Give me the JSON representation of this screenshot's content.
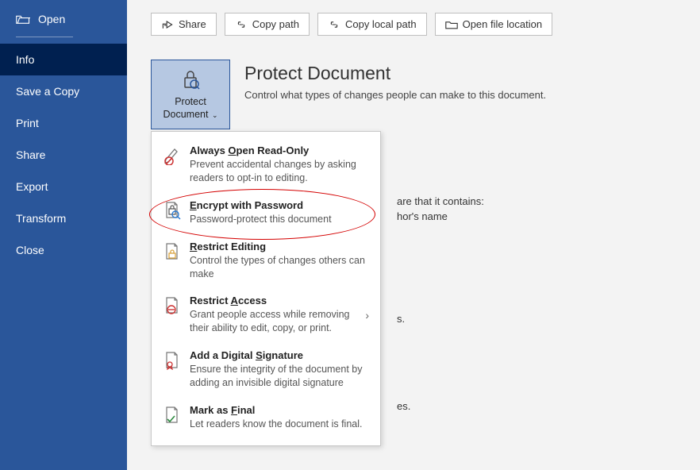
{
  "sidebar": {
    "open_label": "Open",
    "items": [
      "Info",
      "Save a Copy",
      "Print",
      "Share",
      "Export",
      "Transform",
      "Close"
    ],
    "active_index": 0
  },
  "toolbar": {
    "share": "Share",
    "copy_path": "Copy path",
    "copy_local_path": "Copy local path",
    "open_file_location": "Open file location"
  },
  "protect_button": {
    "label_line1": "Protect",
    "label_line2": "Document"
  },
  "heading": {
    "title": "Protect Document",
    "subtitle": "Control what types of changes people can make to this document."
  },
  "background": {
    "line1": "are that it contains:",
    "line2": "hor's name",
    "line3": "s.",
    "line4": "es."
  },
  "dropdown": {
    "items": [
      {
        "title_pre": "Always ",
        "title_key": "O",
        "title_post": "pen Read-Only",
        "sub": "Prevent accidental changes by asking readers to opt-in to editing."
      },
      {
        "title_pre": "",
        "title_key": "E",
        "title_post": "ncrypt with Password",
        "sub": "Password-protect this document"
      },
      {
        "title_pre": "",
        "title_key": "R",
        "title_post": "estrict Editing",
        "sub": "Control the types of changes others can make"
      },
      {
        "title_pre": "Restrict ",
        "title_key": "A",
        "title_post": "ccess",
        "sub": "Grant people access while removing their ability to edit, copy, or print.",
        "has_submenu": true
      },
      {
        "title_pre": "Add a Digital ",
        "title_key": "S",
        "title_post": "ignature",
        "sub": "Ensure the integrity of the document by adding an invisible digital signature"
      },
      {
        "title_pre": "Mark as ",
        "title_key": "F",
        "title_post": "inal",
        "sub": "Let readers know the document is final."
      }
    ]
  }
}
